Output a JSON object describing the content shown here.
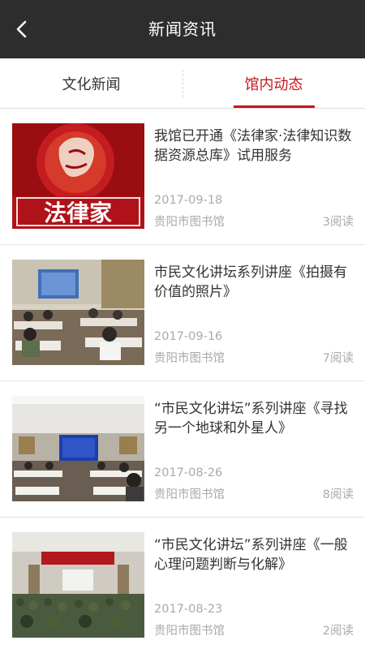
{
  "header": {
    "title": "新闻资讯",
    "back_icon": "chevron-left-icon",
    "background": "#2d2d2d"
  },
  "tabs": [
    {
      "label": "文化新闻",
      "active": false
    },
    {
      "label": "馆内动态",
      "active": true
    }
  ],
  "accent_color": "#c8161d",
  "news": [
    {
      "title": "我馆已开通《法律家·法律知识数据资源总库》试用服务",
      "date": "2017-09-18",
      "source": "贵阳市图书馆",
      "reads": "3阅读",
      "thumb_text": "法律家"
    },
    {
      "title": "市民文化讲坛系列讲座《拍摄有价值的照片》",
      "date": "2017-09-16",
      "source": "贵阳市图书馆",
      "reads": "7阅读"
    },
    {
      "title": "“市民文化讲坛”系列讲座《寻找另一个地球和外星人》",
      "date": "2017-08-26",
      "source": "贵阳市图书馆",
      "reads": "8阅读"
    },
    {
      "title": "“市民文化讲坛”系列讲座《一般心理问题判断与化解》",
      "date": "2017-08-23",
      "source": "贵阳市图书馆",
      "reads": "2阅读"
    }
  ]
}
